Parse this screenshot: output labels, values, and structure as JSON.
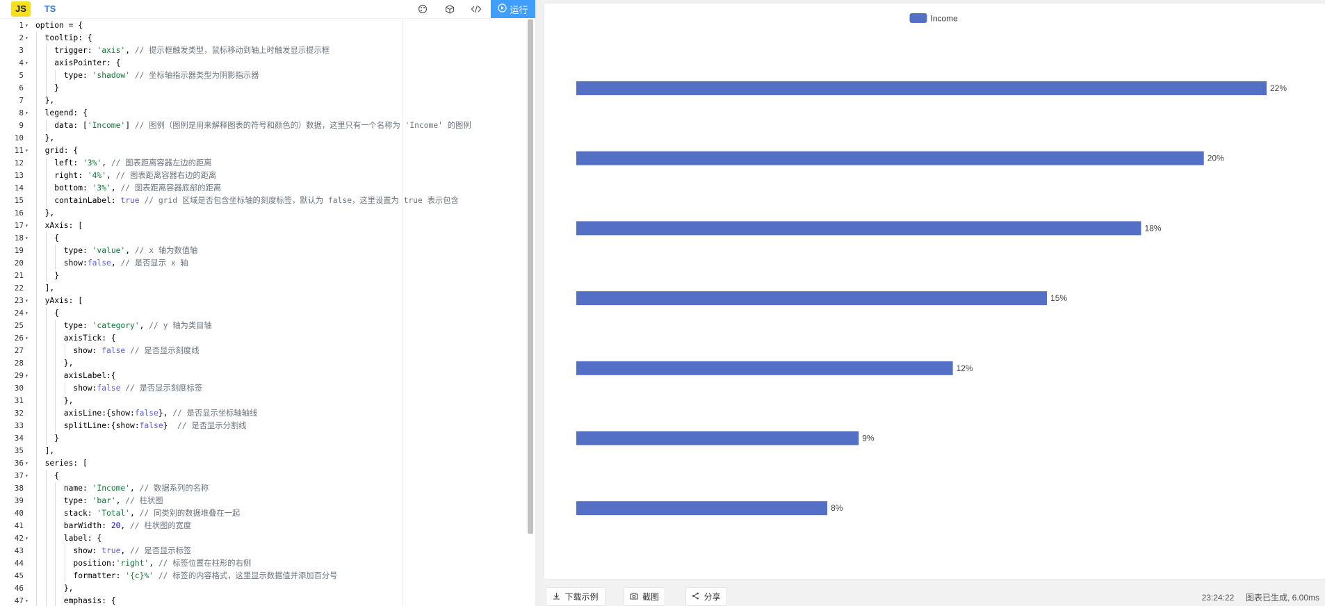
{
  "editor": {
    "tabs": {
      "js": "JS",
      "ts": "TS"
    },
    "toolbar_icons": [
      "palette-icon",
      "cube-icon",
      "code-icon"
    ],
    "run_label": "运行",
    "lines": [
      {
        "n": "1",
        "fold": true,
        "depth": 0,
        "tokens": [
          [
            "k",
            "option = {"
          ]
        ]
      },
      {
        "n": "2",
        "fold": true,
        "depth": 1,
        "tokens": [
          [
            "k",
            "tooltip: {"
          ]
        ]
      },
      {
        "n": "3",
        "fold": false,
        "depth": 2,
        "tokens": [
          [
            "k",
            "trigger: "
          ],
          [
            "s",
            "'axis'"
          ],
          [
            "k",
            ", "
          ],
          [
            "c",
            "// 提示框触发类型，鼠标移动到轴上时触发显示提示框"
          ]
        ]
      },
      {
        "n": "4",
        "fold": true,
        "depth": 2,
        "tokens": [
          [
            "k",
            "axisPointer: {"
          ]
        ]
      },
      {
        "n": "5",
        "fold": false,
        "depth": 3,
        "tokens": [
          [
            "k",
            "type: "
          ],
          [
            "s",
            "'shadow'"
          ],
          [
            "k",
            " "
          ],
          [
            "c",
            "// 坐标轴指示器类型为阴影指示器"
          ]
        ]
      },
      {
        "n": "6",
        "fold": false,
        "depth": 2,
        "tokens": [
          [
            "k",
            "}"
          ]
        ]
      },
      {
        "n": "7",
        "fold": false,
        "depth": 1,
        "tokens": [
          [
            "k",
            "},"
          ]
        ]
      },
      {
        "n": "8",
        "fold": true,
        "depth": 1,
        "tokens": [
          [
            "k",
            "legend: {"
          ]
        ]
      },
      {
        "n": "9",
        "fold": false,
        "depth": 2,
        "tokens": [
          [
            "k",
            "data: ["
          ],
          [
            "s",
            "'Income'"
          ],
          [
            "k",
            "] "
          ],
          [
            "c",
            "// 图例（图例是用来解释图表的符号和颜色的）数据，这里只有一个名称为 'Income' 的图例"
          ]
        ]
      },
      {
        "n": "10",
        "fold": false,
        "depth": 1,
        "tokens": [
          [
            "k",
            "},"
          ]
        ]
      },
      {
        "n": "11",
        "fold": true,
        "depth": 1,
        "tokens": [
          [
            "k",
            "grid: {"
          ]
        ]
      },
      {
        "n": "12",
        "fold": false,
        "depth": 2,
        "tokens": [
          [
            "k",
            "left: "
          ],
          [
            "s",
            "'3%'"
          ],
          [
            "k",
            ", "
          ],
          [
            "c",
            "// 图表距离容器左边的距离"
          ]
        ]
      },
      {
        "n": "13",
        "fold": false,
        "depth": 2,
        "tokens": [
          [
            "k",
            "right: "
          ],
          [
            "s",
            "'4%'"
          ],
          [
            "k",
            ", "
          ],
          [
            "c",
            "// 图表距离容器右边的距离"
          ]
        ]
      },
      {
        "n": "14",
        "fold": false,
        "depth": 2,
        "tokens": [
          [
            "k",
            "bottom: "
          ],
          [
            "s",
            "'3%'"
          ],
          [
            "k",
            ", "
          ],
          [
            "c",
            "// 图表距离容器底部的距离"
          ]
        ]
      },
      {
        "n": "15",
        "fold": false,
        "depth": 2,
        "tokens": [
          [
            "k",
            "containLabel: "
          ],
          [
            "b",
            "true"
          ],
          [
            "k",
            " "
          ],
          [
            "c",
            "// grid 区域是否包含坐标轴的刻度标签，默认为 false，这里设置为 true 表示包含"
          ]
        ]
      },
      {
        "n": "16",
        "fold": false,
        "depth": 1,
        "tokens": [
          [
            "k",
            "},"
          ]
        ]
      },
      {
        "n": "17",
        "fold": true,
        "depth": 1,
        "tokens": [
          [
            "k",
            "xAxis: ["
          ]
        ]
      },
      {
        "n": "18",
        "fold": true,
        "depth": 2,
        "tokens": [
          [
            "k",
            "{"
          ]
        ]
      },
      {
        "n": "19",
        "fold": false,
        "depth": 3,
        "tokens": [
          [
            "k",
            "type: "
          ],
          [
            "s",
            "'value'"
          ],
          [
            "k",
            ", "
          ],
          [
            "c",
            "// x 轴为数值轴"
          ]
        ]
      },
      {
        "n": "20",
        "fold": false,
        "depth": 3,
        "tokens": [
          [
            "k",
            "show:"
          ],
          [
            "b",
            "false"
          ],
          [
            "k",
            ", "
          ],
          [
            "c",
            "// 是否显示 x 轴"
          ]
        ]
      },
      {
        "n": "21",
        "fold": false,
        "depth": 2,
        "tokens": [
          [
            "k",
            "}"
          ]
        ]
      },
      {
        "n": "22",
        "fold": false,
        "depth": 1,
        "tokens": [
          [
            "k",
            "],"
          ]
        ]
      },
      {
        "n": "23",
        "fold": true,
        "depth": 1,
        "tokens": [
          [
            "k",
            "yAxis: ["
          ]
        ]
      },
      {
        "n": "24",
        "fold": true,
        "depth": 2,
        "tokens": [
          [
            "k",
            "{"
          ]
        ]
      },
      {
        "n": "25",
        "fold": false,
        "depth": 3,
        "tokens": [
          [
            "k",
            "type: "
          ],
          [
            "s",
            "'category'"
          ],
          [
            "k",
            ", "
          ],
          [
            "c",
            "// y 轴为类目轴"
          ]
        ]
      },
      {
        "n": "26",
        "fold": true,
        "depth": 3,
        "tokens": [
          [
            "k",
            "axisTick: {"
          ]
        ]
      },
      {
        "n": "27",
        "fold": false,
        "depth": 4,
        "tokens": [
          [
            "k",
            "show: "
          ],
          [
            "b",
            "false"
          ],
          [
            "k",
            " "
          ],
          [
            "c",
            "// 是否显示刻度线"
          ]
        ]
      },
      {
        "n": "28",
        "fold": false,
        "depth": 3,
        "tokens": [
          [
            "k",
            "},"
          ]
        ]
      },
      {
        "n": "29",
        "fold": true,
        "depth": 3,
        "tokens": [
          [
            "k",
            "axisLabel:{"
          ]
        ]
      },
      {
        "n": "30",
        "fold": false,
        "depth": 4,
        "tokens": [
          [
            "k",
            "show:"
          ],
          [
            "b",
            "false"
          ],
          [
            "k",
            " "
          ],
          [
            "c",
            "// 是否显示刻度标签"
          ]
        ]
      },
      {
        "n": "31",
        "fold": false,
        "depth": 3,
        "tokens": [
          [
            "k",
            "},"
          ]
        ]
      },
      {
        "n": "32",
        "fold": false,
        "depth": 3,
        "tokens": [
          [
            "k",
            "axisLine:{show:"
          ],
          [
            "b",
            "false"
          ],
          [
            "k",
            "}, "
          ],
          [
            "c",
            "// 是否显示坐标轴轴线"
          ]
        ]
      },
      {
        "n": "33",
        "fold": false,
        "depth": 3,
        "tokens": [
          [
            "k",
            "splitLine:{show:"
          ],
          [
            "b",
            "false"
          ],
          [
            "k",
            "}  "
          ],
          [
            "c",
            "// 是否显示分割线"
          ]
        ]
      },
      {
        "n": "34",
        "fold": false,
        "depth": 2,
        "tokens": [
          [
            "k",
            "}"
          ]
        ]
      },
      {
        "n": "35",
        "fold": false,
        "depth": 1,
        "tokens": [
          [
            "k",
            "],"
          ]
        ]
      },
      {
        "n": "36",
        "fold": true,
        "depth": 1,
        "tokens": [
          [
            "k",
            "series: ["
          ]
        ]
      },
      {
        "n": "37",
        "fold": true,
        "depth": 2,
        "tokens": [
          [
            "k",
            "{"
          ]
        ]
      },
      {
        "n": "38",
        "fold": false,
        "depth": 3,
        "tokens": [
          [
            "k",
            "name: "
          ],
          [
            "s",
            "'Income'"
          ],
          [
            "k",
            ", "
          ],
          [
            "c",
            "// 数据系列的名称"
          ]
        ]
      },
      {
        "n": "39",
        "fold": false,
        "depth": 3,
        "tokens": [
          [
            "k",
            "type: "
          ],
          [
            "s",
            "'bar'"
          ],
          [
            "k",
            ", "
          ],
          [
            "c",
            "// 柱状图"
          ]
        ]
      },
      {
        "n": "40",
        "fold": false,
        "depth": 3,
        "tokens": [
          [
            "k",
            "stack: "
          ],
          [
            "s",
            "'Total'"
          ],
          [
            "k",
            ", "
          ],
          [
            "c",
            "// 同类别的数据堆叠在一起"
          ]
        ]
      },
      {
        "n": "41",
        "fold": false,
        "depth": 3,
        "tokens": [
          [
            "k",
            "barWidth: "
          ],
          [
            "n",
            "20"
          ],
          [
            "k",
            ", "
          ],
          [
            "c",
            "// 柱状图的宽度"
          ]
        ]
      },
      {
        "n": "42",
        "fold": true,
        "depth": 3,
        "tokens": [
          [
            "k",
            "label: {"
          ]
        ]
      },
      {
        "n": "43",
        "fold": false,
        "depth": 4,
        "tokens": [
          [
            "k",
            "show: "
          ],
          [
            "b",
            "true"
          ],
          [
            "k",
            ", "
          ],
          [
            "c",
            "// 是否显示标签"
          ]
        ]
      },
      {
        "n": "44",
        "fold": false,
        "depth": 4,
        "tokens": [
          [
            "k",
            "position:"
          ],
          [
            "s",
            "'right'"
          ],
          [
            "k",
            ", "
          ],
          [
            "c",
            "// 标签位置在柱形的右侧"
          ]
        ]
      },
      {
        "n": "45",
        "fold": false,
        "depth": 4,
        "tokens": [
          [
            "k",
            "formatter: "
          ],
          [
            "s",
            "'{c}%'"
          ],
          [
            "k",
            " "
          ],
          [
            "c",
            "// 标签的内容格式，这里显示数据值并添加百分号"
          ]
        ]
      },
      {
        "n": "46",
        "fold": false,
        "depth": 3,
        "tokens": [
          [
            "k",
            "},"
          ]
        ]
      },
      {
        "n": "47",
        "fold": true,
        "depth": 3,
        "tokens": [
          [
            "k",
            "emphasis: {"
          ]
        ]
      }
    ]
  },
  "preview": {
    "bottom_buttons": {
      "download": "下载示例",
      "screenshot": "截图",
      "share": "分享"
    },
    "status": {
      "time": "23:24:22",
      "message": "图表已生成, 6.00ms"
    }
  },
  "chart_data": {
    "type": "bar",
    "orientation": "horizontal",
    "legend": [
      "Income"
    ],
    "legend_position": "top-center",
    "series": [
      {
        "name": "Income",
        "values": [
          22,
          20,
          18,
          15,
          12,
          9,
          8
        ],
        "labels": [
          "22%",
          "20%",
          "18%",
          "15%",
          "12%",
          "9%",
          "8%"
        ]
      }
    ],
    "xlim": [
      0,
      22
    ],
    "bar_color": "#5470c6",
    "x_axis_visible": false,
    "y_axis_visible": false,
    "grid": false
  }
}
